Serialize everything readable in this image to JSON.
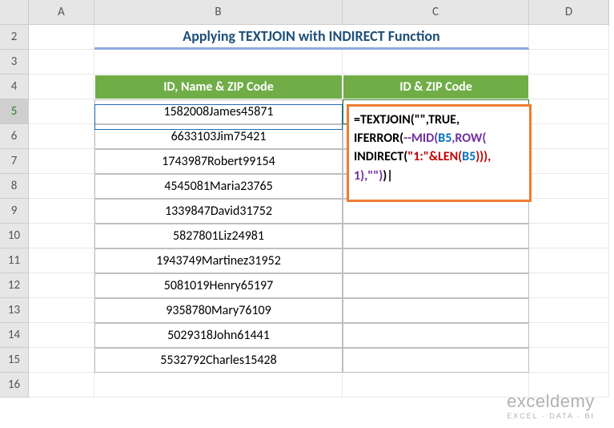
{
  "cols": [
    "",
    "A",
    "B",
    "C",
    "D"
  ],
  "rows": [
    "2",
    "3",
    "4",
    "5",
    "6",
    "7",
    "8",
    "9",
    "10",
    "11",
    "12",
    "13",
    "14",
    "15",
    "16"
  ],
  "selectedRow": "5",
  "title": "Applying TEXTJOIN with INDIRECT Function",
  "headers": {
    "b4": "ID, Name & ZIP Code",
    "c4": "ID & ZIP Code"
  },
  "data_b": [
    "1582008James45871",
    "6633103Jim75421",
    "1743987Robert99154",
    "4545081Maria23765",
    "1339847David31752",
    "5827801Liz24981",
    "1943749Martinez31952",
    "5081019Henry65197",
    "9358780Mary76109",
    "5029318John61441",
    "5532792Charles15428"
  ],
  "formula": {
    "line1_pre": "=TEXTJOIN(\"\",TRUE,",
    "line2_pre": "IFERROR(",
    "mid": "--MID(",
    "b5_1": "B5",
    "comma_row": ",ROW(",
    "line3_ind": "INDIRECT(",
    "line3_str": "\"1:\"&LEN(",
    "b5_2": "B5",
    "line3_close": "))),",
    "line4": "1),\"\")",
    "line4_final": ")"
  },
  "watermark": {
    "big": "exceldemy",
    "small": "EXCEL · DATA · BI"
  }
}
